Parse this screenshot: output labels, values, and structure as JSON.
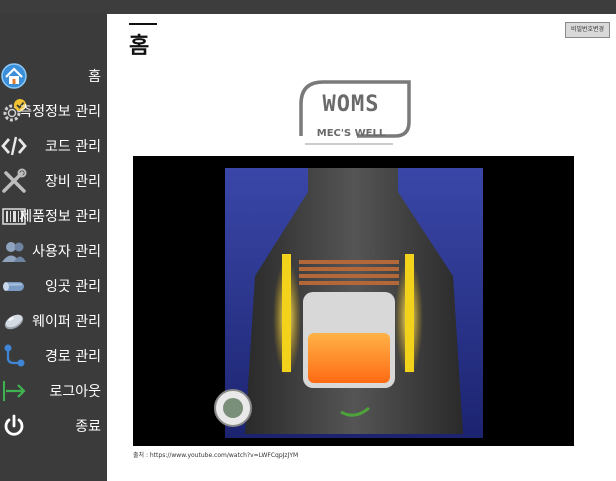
{
  "nav": {
    "items": [
      {
        "label": "홈",
        "icon": "home-icon"
      },
      {
        "label": "측정정보 관리",
        "icon": "gear-check-icon"
      },
      {
        "label": "코드 관리",
        "icon": "code-icon"
      },
      {
        "label": "장비 관리",
        "icon": "tools-icon"
      },
      {
        "label": "제품정보 관리",
        "icon": "barcode-icon"
      },
      {
        "label": "사용자 관리",
        "icon": "users-icon"
      },
      {
        "label": "잉곳 관리",
        "icon": "ingot-icon"
      },
      {
        "label": "웨이퍼 관리",
        "icon": "wafer-icon"
      },
      {
        "label": "경로 관리",
        "icon": "route-icon"
      },
      {
        "label": "로그아웃",
        "icon": "logout-icon"
      },
      {
        "label": "종료",
        "icon": "power-icon"
      }
    ]
  },
  "page": {
    "title": "홈",
    "password_button": "비밀번호변경"
  },
  "logo": {
    "word": "WOMS",
    "subtitle": "MEC'S WELL"
  },
  "video": {
    "source": "출처 : https://www.youtube.com/watch?v=LWFCqpJzJYM"
  },
  "colors": {
    "sidebar": "#3b3b3b",
    "topbar": "#3d3d3d",
    "nav_text": "#ffffff"
  }
}
